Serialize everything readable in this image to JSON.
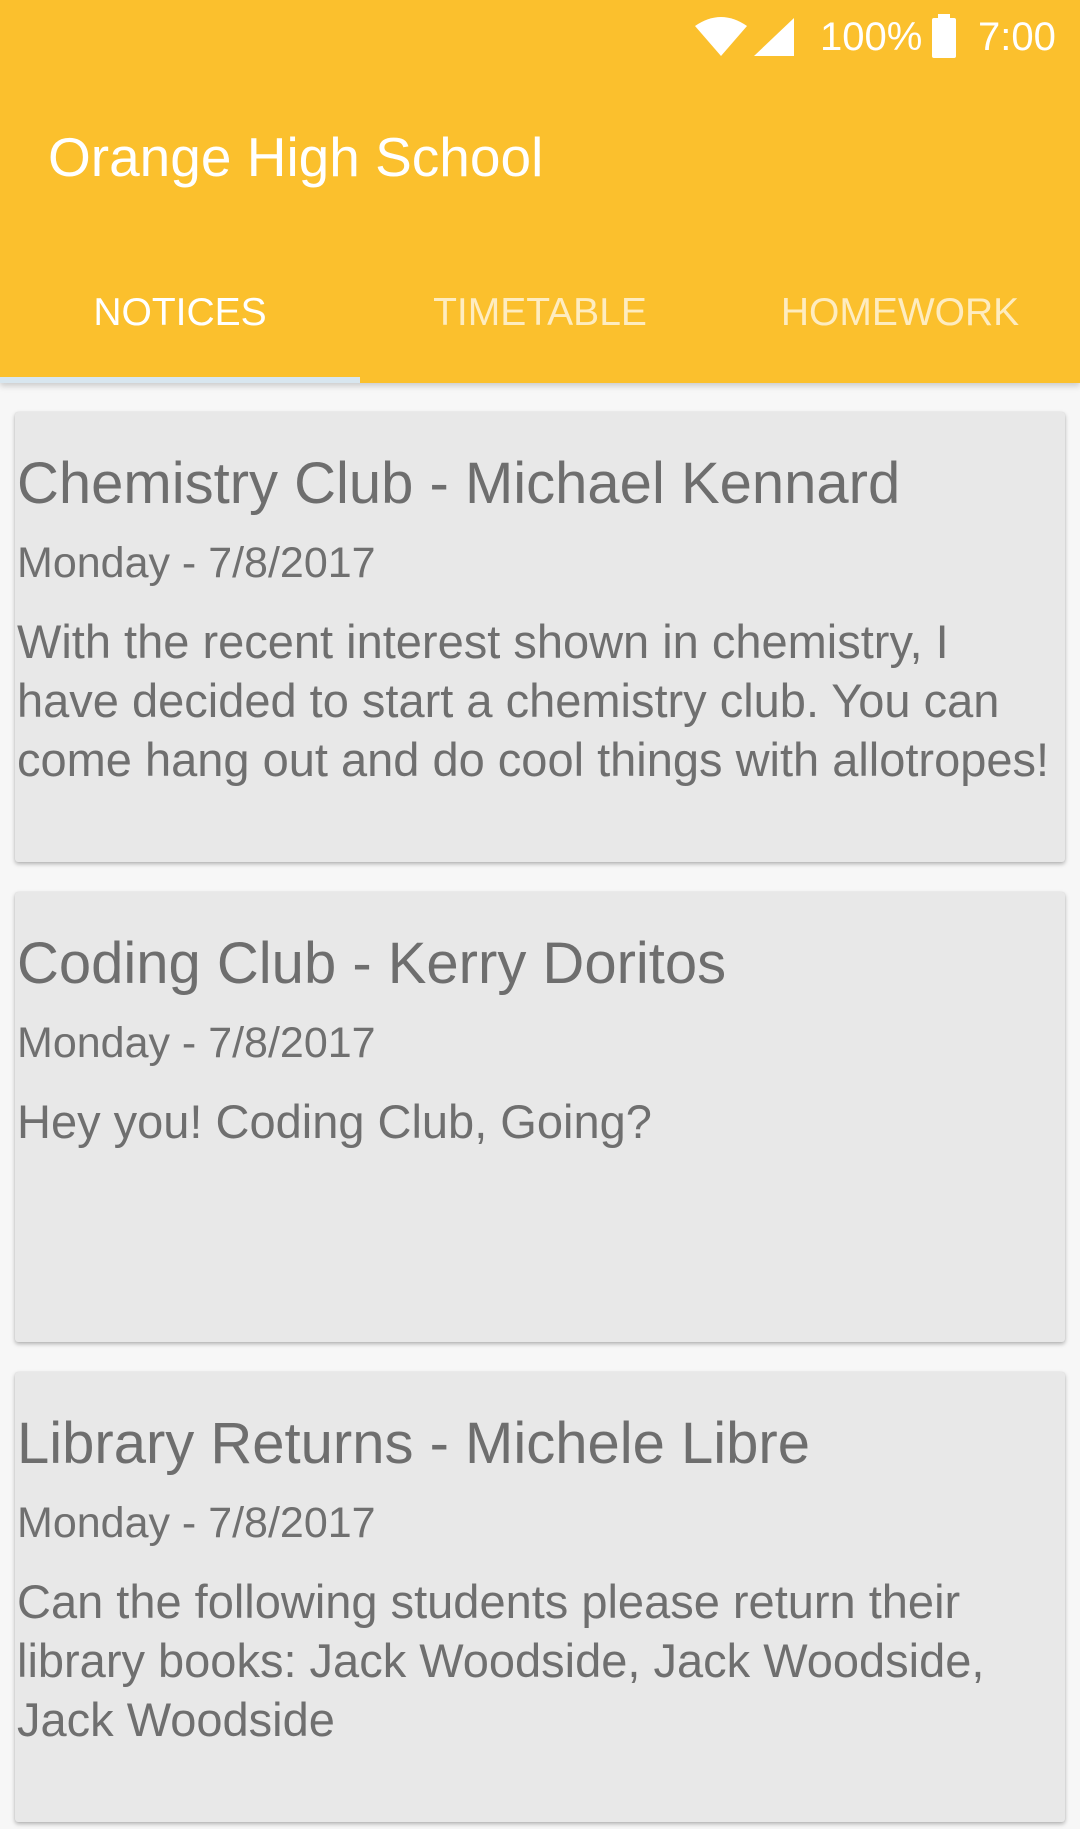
{
  "status_bar": {
    "battery_percent": "100%",
    "time": "7:00",
    "wifi_icon": "wifi-icon",
    "signal_icon": "cell-signal-icon",
    "battery_icon": "battery-full-icon"
  },
  "app_bar": {
    "title": "Orange High School",
    "color": "#fbc02d"
  },
  "tabs": [
    {
      "label": "NOTICES",
      "active": true
    },
    {
      "label": "TIMETABLE",
      "active": false
    },
    {
      "label": "HOMEWORK",
      "active": false
    }
  ],
  "notices": [
    {
      "title": "Chemistry Club - Michael Kennard",
      "date": "Monday - 7/8/2017",
      "body": "With the recent interest shown in chemistry, I have decided to start a chemistry club. You can come hang out and do cool things with allotropes!"
    },
    {
      "title": "Coding Club - Kerry Doritos",
      "date": "Monday - 7/8/2017",
      "body": "Hey you! Coding Club, Going?"
    },
    {
      "title": "Library Returns - Michele Libre",
      "date": "Monday - 7/8/2017",
      "body": "Can the following students please return their library books: Jack Woodside, Jack Woodside, Jack Woodside"
    }
  ]
}
